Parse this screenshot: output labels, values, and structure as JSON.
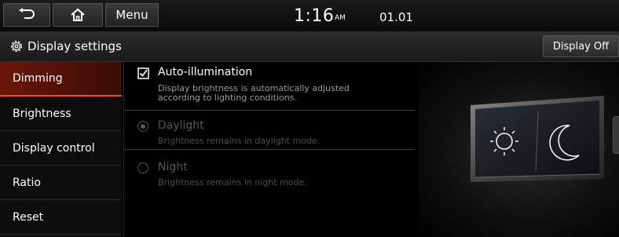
{
  "header": {
    "menu_label": "Menu",
    "clock": "1:16",
    "ampm": "AM",
    "date": "01.01"
  },
  "titlebar": {
    "title": "Display settings",
    "display_off_label": "Display Off"
  },
  "sidebar": {
    "items": [
      {
        "label": "Dimming",
        "active": true
      },
      {
        "label": "Brightness"
      },
      {
        "label": "Display control"
      },
      {
        "label": "Ratio"
      },
      {
        "label": "Reset"
      }
    ]
  },
  "options": {
    "auto": {
      "label": "Auto-illumination",
      "desc1": "Display brightness is automatically adjusted",
      "desc2": "according to lighting conditions.",
      "checked": true
    },
    "daylight": {
      "label": "Daylight",
      "desc": "Brightness remains in daylight mode.",
      "selected": true,
      "enabled": false
    },
    "night": {
      "label": "Night",
      "desc": "Brightness remains in night mode.",
      "selected": false,
      "enabled": false
    }
  },
  "icons": [
    "back-icon",
    "home-icon",
    "gear-icon",
    "checkbox-icon",
    "sun-icon",
    "moon-icon"
  ]
}
